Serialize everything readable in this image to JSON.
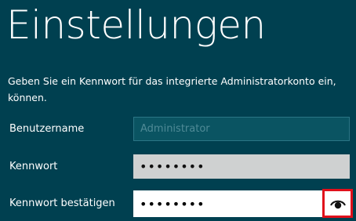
{
  "title": "Einstellungen",
  "description": {
    "line1": "Geben Sie ein Kennwort für das integrierte Administratorkonto ein,",
    "line2": "können."
  },
  "fields": {
    "username": {
      "label": "Benutzername",
      "placeholder": "Administrator"
    },
    "password": {
      "label": "Kennwort",
      "value": "••••••••"
    },
    "confirm": {
      "label": "Kennwort bestätigen",
      "value": "••••••••"
    }
  },
  "icons": {
    "reveal": "eye-icon"
  },
  "colors": {
    "background": "#004050",
    "highlight": "#e0101b"
  }
}
